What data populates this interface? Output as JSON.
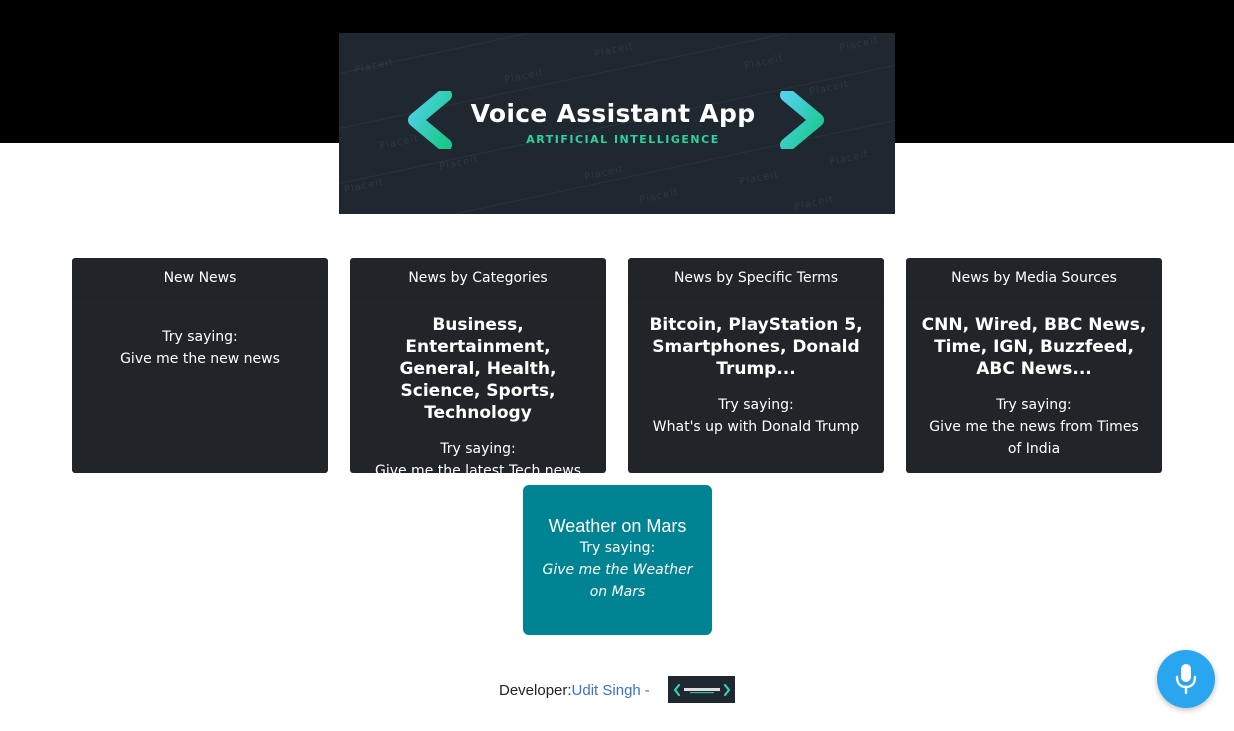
{
  "banner": {
    "title": "Voice Assistant App",
    "subtitle": "ARTIFICIAL INTELLIGENCE",
    "watermark": "Placeit",
    "accent_color": "#2fd39a"
  },
  "cards": [
    {
      "header": "New News",
      "title": "",
      "try_label": "Try saying:",
      "example": "Give me the new news"
    },
    {
      "header": "News by Categories",
      "title": "Business, Entertainment, General, Health, Science, Sports, Technology",
      "try_label": "Try saying:",
      "example": "Give me the latest Tech news"
    },
    {
      "header": "News by Specific Terms",
      "title": "Bitcoin, PlayStation 5, Smartphones, Donald Trump...",
      "try_label": "Try saying:",
      "example": "What's up with Donald Trump"
    },
    {
      "header": "News by Media Sources",
      "title": "CNN, Wired, BBC News, Time, IGN, Buzzfeed, ABC News...",
      "try_label": "Try saying:",
      "example": "Give me the news from Times of India"
    }
  ],
  "mars_card": {
    "title": "Weather on Mars",
    "try_label": "Try saying:",
    "example": "Give me the Weather on Mars",
    "color": "#008392"
  },
  "footer": {
    "label": "Developer:",
    "developer_name": "Udit Singh",
    "separator": "-",
    "logo_text": "Voice Assistant App"
  },
  "mic_button": {
    "icon": "microphone-icon",
    "color": "#2aa6f0"
  }
}
